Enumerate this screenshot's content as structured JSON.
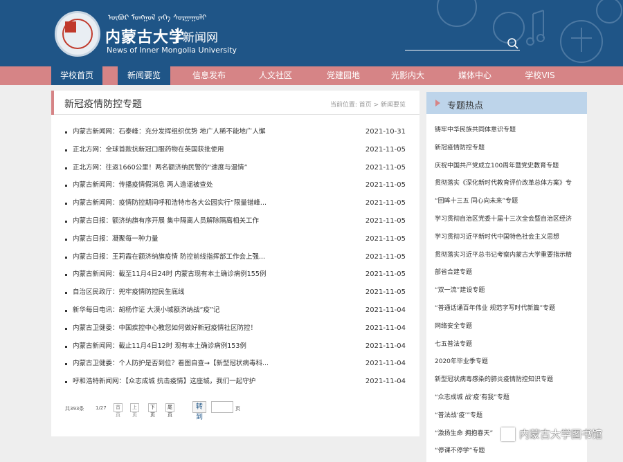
{
  "header": {
    "mongolian_text": "ᠥᠪᠦᠷ ᠮᠣᠩᠭᠣᠯ ᠶᠡᠬᠡ ᠰᠤᠷᠭᠠᠭᠤᠯᠢ",
    "university_name": "内蒙古大学",
    "site_name": "新闻网",
    "english_name": "News of Inner Mongolia University",
    "search_icon": "search-icon",
    "brand_color": "#1f5587"
  },
  "nav": {
    "accent_color": "#d68486",
    "items": [
      {
        "label": "学校首页",
        "active": true
      },
      {
        "label": "新闻要览",
        "active": true
      },
      {
        "label": "信息发布",
        "active": false
      },
      {
        "label": "人文社区",
        "active": false
      },
      {
        "label": "党建园地",
        "active": false
      },
      {
        "label": "光影内大",
        "active": false
      },
      {
        "label": "媒体中心",
        "active": false
      },
      {
        "label": "学校VIS",
        "active": false
      }
    ]
  },
  "main": {
    "title": "新冠疫情防控专题",
    "breadcrumb": "当前位置: 首页 > 新闻要览",
    "news": [
      {
        "title": "内蒙古新闻网：石泰峰：充分发挥组织优势 地广人稀不能地广人懈",
        "date": "2021-10-31"
      },
      {
        "title": "正北方网：全球首款抗新冠口服药物在英国获批使用",
        "date": "2021-11-05"
      },
      {
        "title": "正北方网：往返1660公里！两名额济纳民警的“速度与温情”",
        "date": "2021-11-05"
      },
      {
        "title": "内蒙古新闻网：传播疫情假消息 两人造谣被查处",
        "date": "2021-11-05"
      },
      {
        "title": "内蒙古新闻网：疫情防控期间呼和浩特市各大公园实行“限量错峰...",
        "date": "2021-11-05"
      },
      {
        "title": "内蒙古日报：额济纳旗有序开展 集中隔离人员解除隔离相关工作",
        "date": "2021-11-05"
      },
      {
        "title": "内蒙古日报：凝聚每一种力量",
        "date": "2021-11-05"
      },
      {
        "title": "内蒙古日报：王莉霞在额济纳旗疫情 防控前线指挥部工作会上强...",
        "date": "2021-11-05"
      },
      {
        "title": "内蒙古新闻网：截至11月4日24时 内蒙古现有本土确诊病例155例",
        "date": "2021-11-05"
      },
      {
        "title": "自治区民政厅：兜牢疫情防控民生底线",
        "date": "2021-11-05"
      },
      {
        "title": "新华每日电讯：胡杨作证 大漠小城额济纳战“疫”记",
        "date": "2021-11-04"
      },
      {
        "title": "内蒙古卫健委：中国疾控中心教您如何做好新冠疫情社区防控！",
        "date": "2021-11-04"
      },
      {
        "title": "内蒙古新闻网：截止11月4日12时 现有本土确诊病例153例",
        "date": "2021-11-04"
      },
      {
        "title": "内蒙古卫健委：个人防护是否到位？看图自查→【新型冠状病毒科...",
        "date": "2021-11-04"
      },
      {
        "title": "呼和浩特新闻网：【众志成城 抗击疫情】这座城，我们一起守护",
        "date": "2021-11-04"
      }
    ],
    "pager": {
      "total": "共393条",
      "page": "1/27",
      "first": "首页",
      "prev": "上页",
      "next": "下页",
      "last": "尾页",
      "go": "转到",
      "page_unit": "页"
    }
  },
  "side": {
    "title": "专题热点",
    "topics": [
      "铸牢中华民族共同体意识专题",
      "新冠疫情防控专题",
      "庆祝中国共产党成立100周年暨党史教育专题",
      "贯彻落实《深化新时代教育评价改革总体方案》专",
      "“回眸十三五 同心向未来”专题",
      "学习贯彻自治区党委十届十三次全会暨自治区经济",
      "学习贯彻习近平新时代中国特色社会主义思想",
      "贯彻落实习近平总书记考察内蒙古大学重要指示精",
      "部省合建专题",
      "“双一流”建设专题",
      "“普通话诵百年伟业 规范字写时代新篇”专题",
      "网络安全专题",
      "七五普法专题",
      "2020年毕业季专题",
      "新型冠状病毒感染的肺炎疫情防控知识专题",
      "“众志成城 战‘疫’有我”专题",
      "“普法战‘疫’”专题",
      "“激扬生命 拥抱春天”",
      "“停课不停学”专题"
    ]
  },
  "watermark": {
    "text": "内蒙古大学图书馆"
  }
}
